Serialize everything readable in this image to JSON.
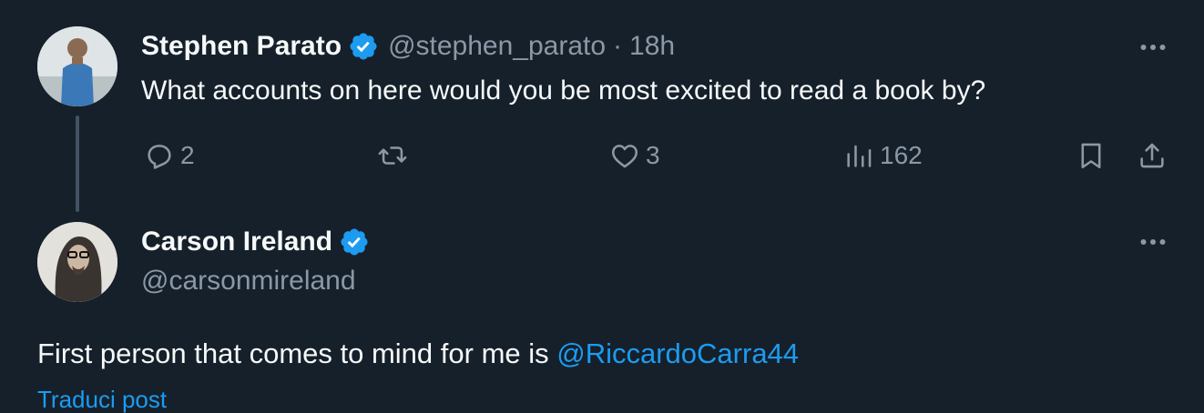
{
  "tweet": {
    "author_name": "Stephen Parato",
    "handle": "@stephen_parato",
    "separator": "·",
    "time": "18h",
    "text": "What accounts on here would you be most excited to read a book by?",
    "replies": "2",
    "likes": "3",
    "views": "162"
  },
  "reply": {
    "author_name": "Carson Ireland",
    "handle": "@carsonmireland",
    "text_prefix": "First person that comes to mind for me is ",
    "mention": "@RiccardoCarra44",
    "translate_label": "Traduci post"
  },
  "icons": {
    "verified": "verified-badge-icon",
    "more": "more-horizontal-icon",
    "reply": "reply-icon",
    "retweet": "retweet-icon",
    "like": "heart-icon",
    "views": "views-chart-icon",
    "bookmark": "bookmark-icon",
    "share": "share-icon"
  },
  "colors": {
    "background": "#15202b",
    "text": "#f7f9f9",
    "secondary": "#8b98a5",
    "accent": "#1d9bf0"
  }
}
